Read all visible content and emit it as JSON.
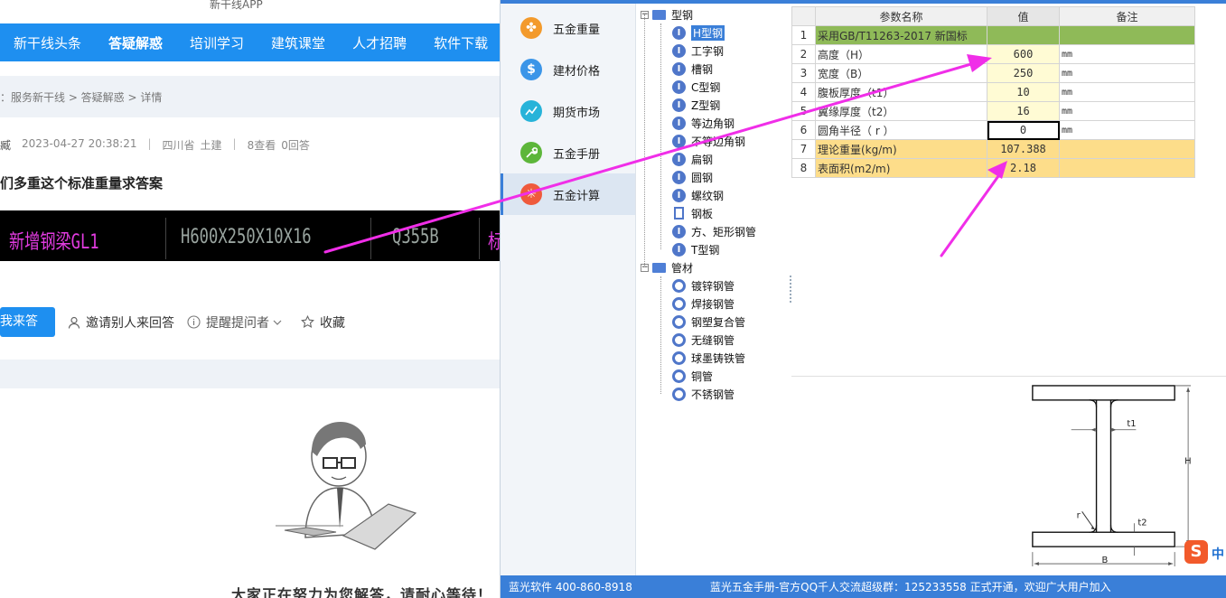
{
  "website": {
    "app_title": "新干线APP",
    "nav": [
      "新干线头条",
      "答疑解惑",
      "培训学习",
      "建筑课堂",
      "人才招聘",
      "软件下载"
    ],
    "breadcrumb": "：服务新干线 > 答疑解惑 > 详情",
    "meta": {
      "user": "臧",
      "datetime": "2023-04-27 20:38:21",
      "region": "四川省",
      "category": "土建",
      "views": "8查看",
      "answers": "0回答"
    },
    "question_title": "们多重这个标准重量求答案",
    "cad": {
      "label_left": "新增钢梁GL1",
      "label_mid": "H600X250X10X16",
      "label_right": "Q355B",
      "label_cut": "标"
    },
    "actions": {
      "answer": "我来答",
      "invite": "邀请别人来回答",
      "remind": "提醒提问者",
      "collect": "收藏"
    },
    "waiting_text": "大家正在努力为您解答，请耐心等待！"
  },
  "app": {
    "sidebar": [
      {
        "label": "五金重量",
        "icon": "clover-icon",
        "color": "#f39a2c"
      },
      {
        "label": "建材价格",
        "icon": "dollar-icon",
        "color": "#3b95e8"
      },
      {
        "label": "期货市场",
        "icon": "trend-icon",
        "color": "#27b3d9"
      },
      {
        "label": "五金手册",
        "icon": "wrench-icon",
        "color": "#5db63a"
      },
      {
        "label": "五金计算",
        "icon": "calc-icon",
        "color": "#ef5a3c"
      }
    ],
    "tree": {
      "group1": "型钢",
      "group1_items": [
        "H型钢",
        "工字钢",
        "槽钢",
        "C型钢",
        "Z型钢",
        "等边角钢",
        "不等边角钢",
        "扁钢",
        "圆钢",
        "螺纹钢",
        "钢板",
        "方、矩形钢管",
        "T型钢"
      ],
      "group2": "管材",
      "group2_items": [
        "镀锌钢管",
        "焊接钢管",
        "钢塑复合管",
        "无缝钢管",
        "球墨铸铁管",
        "铜管",
        "不锈钢管"
      ]
    },
    "grid": {
      "headers": [
        "参数名称",
        "值",
        "备注"
      ],
      "rows": [
        {
          "n": "1",
          "name": "采用GB/T11263-2017 新国标",
          "value": "",
          "note": ""
        },
        {
          "n": "2",
          "name": "高度（H）",
          "value": "600",
          "note": "mm"
        },
        {
          "n": "3",
          "name": "宽度（B）",
          "value": "250",
          "note": "mm"
        },
        {
          "n": "4",
          "name": "腹板厚度（t1）",
          "value": "10",
          "note": "mm"
        },
        {
          "n": "5",
          "name": "翼缘厚度（t2）",
          "value": "16",
          "note": "mm"
        },
        {
          "n": "6",
          "name": "圆角半径（ r ）",
          "value": "0",
          "note": "mm"
        },
        {
          "n": "7",
          "name": "理论重量(kg/m)",
          "value": "107.388",
          "note": ""
        },
        {
          "n": "8",
          "name": "表面积(m2/m)",
          "value": "2.18",
          "note": ""
        }
      ]
    },
    "diagram_labels": {
      "t1": "t1",
      "t2": "t2",
      "H": "H",
      "B": "B",
      "r": "r"
    },
    "status": {
      "left": "蓝光软件 400-860-8918",
      "right": "蓝光五金手册-官方QQ千人交流超级群：125233558 正式开通，欢迎广大用户加入"
    },
    "ime": {
      "logo": "S",
      "lang": "中"
    }
  },
  "colors": {
    "nav_blue": "#1e8ff0",
    "arrow": "#f02ee8",
    "standard_row": "#8fba58",
    "result_row": "#fddd8a"
  }
}
